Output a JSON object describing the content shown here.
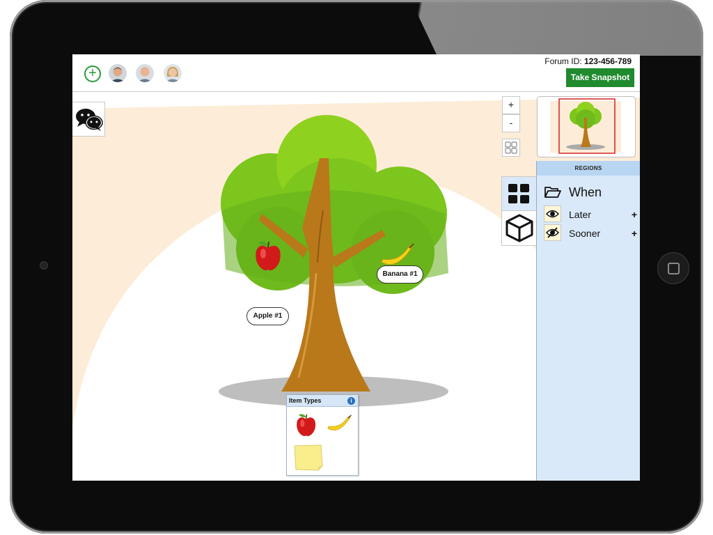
{
  "toolbar": {
    "add_icon": "plus-circle-icon",
    "participants": [
      {
        "name": "participant-1",
        "skin": "#e0a98a",
        "hair": "#4a2e1e",
        "shirt": "#3a4a5a"
      },
      {
        "name": "participant-2",
        "skin": "#eab394",
        "hair": "#c98e6a",
        "shirt": "#6a7a8a"
      },
      {
        "name": "participant-3",
        "skin": "#edc7a4",
        "hair": "#c8a05c",
        "shirt": "#7a8a9a"
      }
    ],
    "forum_label": "Forum ID:",
    "forum_id": "123-456-789",
    "snapshot_label": "Take Snapshot"
  },
  "zoom": {
    "in_label": "+",
    "out_label": "-"
  },
  "canvas": {
    "labels": {
      "apple": "Apple #1",
      "banana": "Banana #1"
    }
  },
  "regions": {
    "header": "REGIONS",
    "folder": {
      "icon": "folder-open-icon",
      "label": "When"
    },
    "items": [
      {
        "label": "Later",
        "icon": "eye-icon",
        "action": "+"
      },
      {
        "label": "Sooner",
        "icon": "eye-slash-icon",
        "action": "+"
      }
    ]
  },
  "item_types": {
    "title": "Item Types",
    "items": [
      "apple-icon",
      "banana-icon",
      "sticky-note-icon"
    ]
  },
  "colors": {
    "accent_green": "#1f8a2e",
    "panel_blue": "#d9e9f9",
    "panel_header": "#b8d5f2",
    "canvas_background": "#fdecd7"
  }
}
